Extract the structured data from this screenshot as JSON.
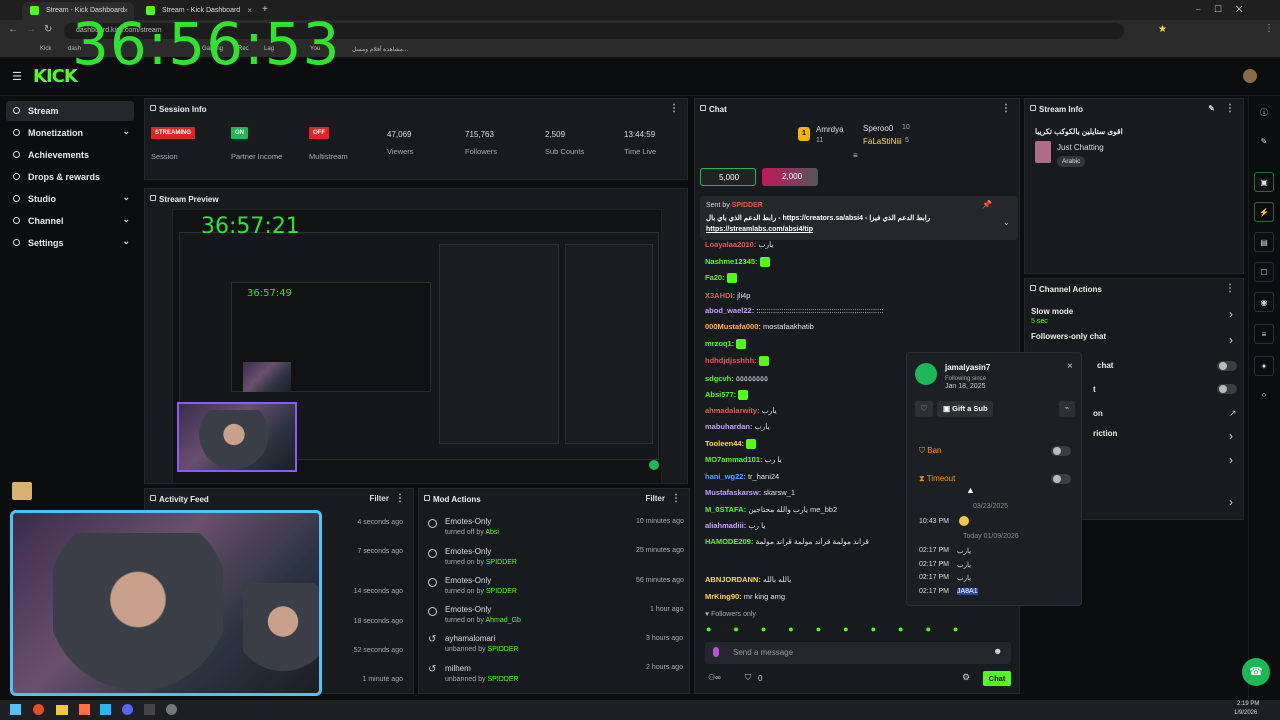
{
  "browser": {
    "tabs": [
      {
        "label": "Stream - Kick Dashboard"
      },
      {
        "label": "Stream - Kick Dashboard"
      }
    ],
    "new_tab": "+",
    "url": "dashboard.kick.com/stream",
    "bookmarks": [
      "Kick",
      "dash",
      "Gaming",
      "Rec",
      "Lag",
      "You",
      "مشاهدة أفلام ومسل..."
    ]
  },
  "overlay_timer": "36:56:53",
  "logo": "KICK",
  "sidebar": {
    "items": [
      {
        "label": "Stream",
        "active": true,
        "chevron": false
      },
      {
        "label": "Monetization",
        "chevron": true
      },
      {
        "label": "Achievements",
        "chevron": false
      },
      {
        "label": "Drops & rewards",
        "chevron": false
      },
      {
        "label": "Studio",
        "chevron": true
      },
      {
        "label": "Channel",
        "chevron": true
      },
      {
        "label": "Settings",
        "chevron": true
      }
    ]
  },
  "session": {
    "title": "Session Info",
    "stats": [
      {
        "badge": "STREAMING",
        "badge_color": "#e02424",
        "label": "Session"
      },
      {
        "badge": "ON",
        "badge_color": "#1db954",
        "label": "Partner Income"
      },
      {
        "badge": "OFF",
        "badge_color": "#e02424",
        "label": "Multistream"
      },
      {
        "value": "47,069",
        "label": "Viewers"
      },
      {
        "value": "715,763",
        "label": "Followers"
      },
      {
        "value": "2,509",
        "label": "Sub Counts"
      },
      {
        "value": "13:44:59",
        "label": "Time Live"
      }
    ]
  },
  "preview": {
    "title": "Stream Preview",
    "timer1": "36:57:21",
    "timer2": "36:57:49"
  },
  "activity": {
    "title": "Activity Feed",
    "filter": "Filter",
    "times": [
      "4 seconds ago",
      "7 seconds ago",
      "14 seconds ago",
      "18 seconds ago",
      "52 seconds ago",
      "1 minute ago"
    ]
  },
  "mod": {
    "title": "Mod Actions",
    "filter": "Filter",
    "rows": [
      {
        "action": "Emotes-Only",
        "detail_prefix": "turned off by",
        "user": "Absi",
        "time": "10 minutes ago"
      },
      {
        "action": "Emotes-Only",
        "detail_prefix": "turned on by",
        "user": "SPIDDER",
        "time": "25 minutes ago"
      },
      {
        "action": "Emotes-Only",
        "detail_prefix": "turned on by",
        "user": "SPIDDER",
        "time": "56 minutes ago"
      },
      {
        "action": "Emotes-Only",
        "detail_prefix": "turned on by",
        "user": "Ahmad_Gb",
        "time": "1 hour ago"
      },
      {
        "action": "ayhamalomari",
        "detail_prefix": "unbanned by",
        "user": "SPIDDER",
        "time": "3 hours ago"
      },
      {
        "action": "milhem",
        "detail_prefix": "unbanned by",
        "user": "SPIDDER",
        "time": "2 hours ago"
      }
    ]
  },
  "chat": {
    "title": "Chat",
    "leaderboard": [
      {
        "rank": "1",
        "name": "Amrdya",
        "count": "11"
      },
      {
        "name": "Speroo0",
        "count": "10"
      },
      {
        "name": "FaLaStiNiii",
        "count": "5"
      }
    ],
    "gift_pills": [
      "5,000",
      "2,000"
    ],
    "pinned": {
      "sent_by": "Sent by",
      "sender": "SPIDDER",
      "text": "رابط الدعم الذي باي بال - https://creators.sa/absi4 - رابط الدعم الذي فيزا",
      "link": "https://streamlabs.com/absi4/tip"
    },
    "messages": [
      {
        "user": "Loayalaa2010:",
        "text": "يارب",
        "color": "#e05a5a"
      },
      {
        "user": "Nashme12345:",
        "text": "",
        "color": "#53fc18"
      },
      {
        "user": "Fa20:",
        "text": "",
        "color": "#53fc18"
      },
      {
        "user": "X3AHDI:",
        "text": "jli4p",
        "color": "#e05a5a"
      },
      {
        "user": "abod_wael22:",
        "text": ":::::::::::::::::::::::::::::::::::::::::::::::::::::::::::::",
        "color": "#c8a0ff"
      },
      {
        "user": "000Mustafa000:",
        "text": "mostafaakhatib",
        "color": "#ffb347"
      },
      {
        "user": "mrzoq1:",
        "text": "",
        "color": "#53fc18"
      },
      {
        "user": "hdhdjdjsshhh:",
        "text": "",
        "color": "#e05a5a"
      },
      {
        "user": "sdgcvh:",
        "text": "٥٥٥٥٥٥٥٥",
        "color": "#53fc18"
      },
      {
        "user": "Absi577:",
        "text": "",
        "color": "#53fc18"
      },
      {
        "user": "ahmadalarwity:",
        "text": "يارب",
        "color": "#e05a5a"
      },
      {
        "user": "mabuhardan:",
        "text": "يارب",
        "color": "#c8a0ff"
      },
      {
        "user": "Tooleen44:",
        "text": "",
        "color": "#ffd54f"
      },
      {
        "user": "MO7ammad101:",
        "text": "يا رب",
        "color": "#53fc18"
      },
      {
        "user": "hani_wg22:",
        "text": "tr_hani24",
        "color": "#4fa3ff"
      },
      {
        "user": "Mustafaskarsw:",
        "text": "skarsw_1",
        "color": "#c8a0ff"
      },
      {
        "user": "M_0STAFA:",
        "text": "يارب والله محتاجين me_bb2",
        "color": "#53fc18"
      },
      {
        "user": "aliahmadiii:",
        "text": "يا رب",
        "color": "#c8a0ff"
      },
      {
        "user": "HAMODE209:",
        "text": "قراند مولمة قراند مولمة قراند مولمة",
        "color": "#53fc18"
      },
      {
        "user": "ABNJORDANN:",
        "text": "بالله بالله",
        "color": "#ffd54f"
      },
      {
        "user": "MrKing90:",
        "text": "mr king amg",
        "color": "#ffd54f"
      }
    ],
    "followers_only": "Followers only",
    "placeholder": "Send a message",
    "count": "0",
    "send": "Chat"
  },
  "user_card": {
    "name": "jamalyasin7",
    "following_since": "Following since",
    "date": "Jan 18, 2025",
    "gift": "Gift a Sub",
    "ban": "Ban",
    "timeout": "Timeout",
    "date_sep1": "03/23/2025",
    "date_sep2": "Today 01/09/2026",
    "messages": [
      {
        "time": "10:43 PM",
        "text": ""
      },
      {
        "time": "02:17 PM",
        "text": "يارب"
      },
      {
        "time": "02:17 PM",
        "text": "يارب"
      },
      {
        "time": "02:17 PM",
        "text": "يارب"
      },
      {
        "time": "02:17 PM",
        "text": "JA8A1"
      }
    ]
  },
  "stream_info": {
    "title": "Stream Info",
    "stream_title": "اقوى ستايلين بالكوكب تكريبا",
    "category": "Just Chatting",
    "language": "Arabic"
  },
  "channel_actions": {
    "title": "Channel Actions",
    "slow_mode": "Slow mode",
    "slow_value": "5 sec",
    "followers_only": "Followers-only chat",
    "row3": "chat",
    "row4": "t",
    "row5": "on",
    "row6": "riction"
  },
  "taskbar": {
    "time": "2:19 PM",
    "date": "1/9/2026"
  }
}
